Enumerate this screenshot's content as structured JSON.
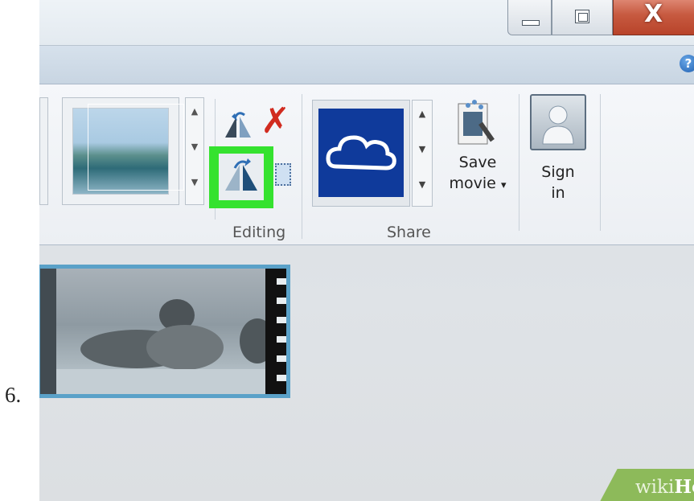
{
  "step": {
    "number": "6."
  },
  "window": {
    "minimize_icon": "minimize-icon",
    "maximize_icon": "restore-icon",
    "close_glyph": "X"
  },
  "help": {
    "glyph": "?"
  },
  "ribbon": {
    "editing": {
      "group_label": "Editing",
      "highlight_color": "#35e22f"
    },
    "share": {
      "group_label": "Share",
      "tile_color": "#0f3a9b"
    },
    "save_movie": {
      "line1": "Save",
      "line2": "movie",
      "dropdown": "▾"
    },
    "sign_in": {
      "line1": "Sign",
      "line2": "in"
    }
  },
  "watermark": {
    "part1": "wiki",
    "part2": "How"
  }
}
